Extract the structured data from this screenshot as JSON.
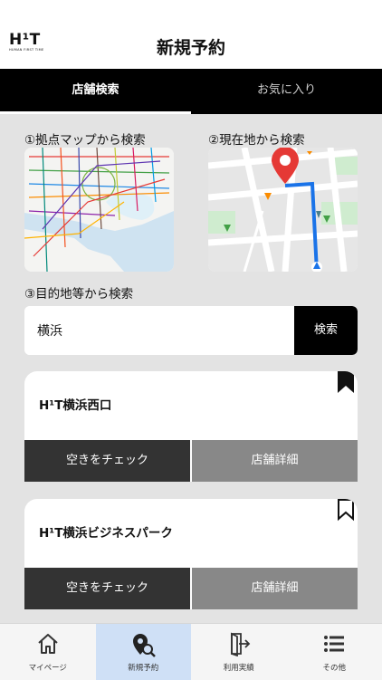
{
  "header": {
    "logo_mark": "H¹T",
    "logo_sub": "HUMAN FIRST TIME",
    "title": "新規予約"
  },
  "tabs": [
    {
      "label": "店舗検索",
      "active": true
    },
    {
      "label": "お気に入り",
      "active": false
    }
  ],
  "sections": {
    "map_search": "①拠点マップから検索",
    "location_search": "②現在地から検索",
    "destination_search": "③目的地等から検索"
  },
  "search": {
    "value": "横浜",
    "button_label": "検索"
  },
  "stores": [
    {
      "name": "H¹T横浜西口",
      "bookmarked": true,
      "availability_label": "空きをチェック",
      "detail_label": "店舗詳細"
    },
    {
      "name": "H¹T横浜ビジネスパーク",
      "bookmarked": false,
      "availability_label": "空きをチェック",
      "detail_label": "店舗詳細"
    }
  ],
  "navbar": [
    {
      "label": "マイページ",
      "icon": "home-icon",
      "active": false
    },
    {
      "label": "新規予約",
      "icon": "map-pin-search-icon",
      "active": true
    },
    {
      "label": "利用実績",
      "icon": "door-exit-icon",
      "active": false
    },
    {
      "label": "その他",
      "icon": "list-icon",
      "active": false
    }
  ],
  "colors": {
    "background": "#e3e3e3",
    "primary": "#000000",
    "active_nav": "#cfe0f6",
    "button_dark": "#333333",
    "button_gray": "#888888",
    "pin_red": "#e53935",
    "route_blue": "#1a73e8"
  }
}
